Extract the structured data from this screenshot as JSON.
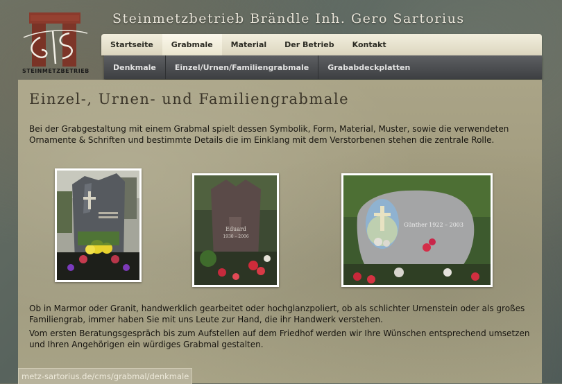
{
  "header": {
    "title": "Steinmetzbetrieb Brändle Inh. Gero Sartorius",
    "logo_text": "STEINMETZBETRIEB"
  },
  "nav_primary": [
    {
      "label": "Startseite"
    },
    {
      "label": "Grabmale"
    },
    {
      "label": "Material"
    },
    {
      "label": "Der Betrieb"
    },
    {
      "label": "Kontakt"
    }
  ],
  "nav_secondary": [
    {
      "label": "Denkmale"
    },
    {
      "label": "Einzel/Urnen/Familiengrabmale"
    },
    {
      "label": "Grababdeckplatten"
    }
  ],
  "main": {
    "heading": "Einzel-, Urnen- und Familiengrabmale",
    "intro": "Bei der Grabgestaltung mit einem Grabmal spielt dessen Symbolik, Form, Material, Muster, sowie die verwendeten Ornamente & Schriften und bestimmte Details die im Einklang mit dem Verstorbenen stehen die zentrale Rolle.",
    "para1": "Ob in Marmor oder Granit, handwerklich gearbeitet oder hochglanzpoliert, ob als schlichter Urnenstein oder als großes Familiengrab, immer haben Sie mit uns Leute zur Hand, die ihr Handwerk verstehen.",
    "para2": "Vom ersten Beratungsgespräch bis zum Aufstellen auf dem Friedhof werden wir Ihre Wünschen entsprechend umsetzen und Ihren Angehörigen ein würdiges Grabmal gestalten.",
    "photos": [
      {
        "inscription": "",
        "alt": "grave-photo-1"
      },
      {
        "inscription": "Eduard 1930 – 2006",
        "alt": "grave-photo-2"
      },
      {
        "inscription": "Günther 1922 – 2003",
        "alt": "grave-photo-3"
      }
    ]
  },
  "status_bar": {
    "url": "metz-sartorius.de/cms/grabmal/denkmale"
  },
  "colors": {
    "nav_active": "#f7f3e3",
    "content_bg": "#a39d80",
    "nav2_bg": "#4a4c4f"
  }
}
